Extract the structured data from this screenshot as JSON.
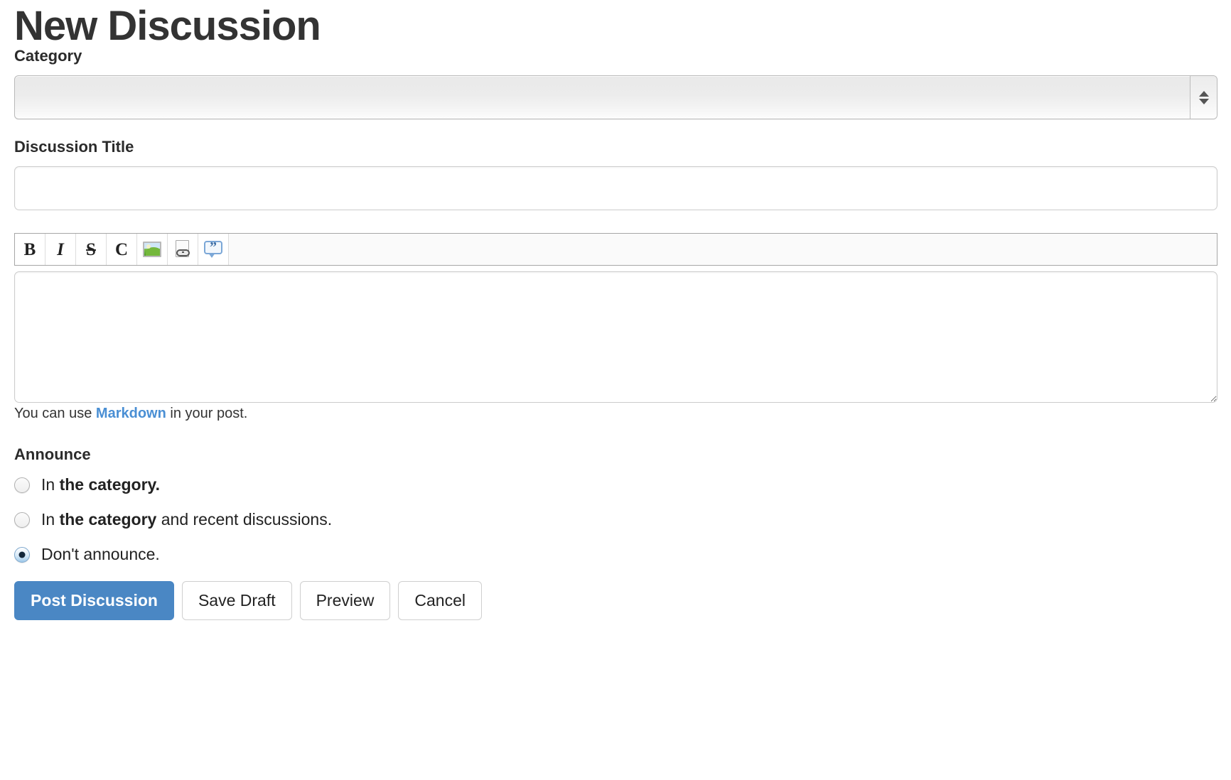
{
  "page": {
    "title": "New Discussion"
  },
  "category": {
    "label": "Category",
    "selected_value": "",
    "stepper_icon": "up-down-arrows-icon"
  },
  "discussion_title": {
    "label": "Discussion Title",
    "value": "",
    "placeholder": ""
  },
  "editor": {
    "toolbar": [
      {
        "name": "bold-button",
        "glyph": "B",
        "style": "bold"
      },
      {
        "name": "italic-button",
        "glyph": "I",
        "style": "italic"
      },
      {
        "name": "strikethrough-button",
        "glyph": "S",
        "style": "strike"
      },
      {
        "name": "code-button",
        "glyph": "C",
        "style": "code"
      },
      {
        "name": "insert-image-button",
        "glyph": "",
        "style": "image-icon"
      },
      {
        "name": "insert-link-button",
        "glyph": "",
        "style": "link-icon"
      },
      {
        "name": "blockquote-button",
        "glyph": "”",
        "style": "quote-icon"
      }
    ],
    "body_value": "",
    "body_placeholder": "",
    "resize_handle_icon": "resize-grip-icon"
  },
  "help": {
    "prefix": "You can use ",
    "link_text": "Markdown",
    "suffix": " in your post."
  },
  "announce": {
    "heading": "Announce",
    "options": [
      {
        "name": "announce-in-category",
        "prefix": "In ",
        "strong": "the category.",
        "suffix": "",
        "checked": false
      },
      {
        "name": "announce-in-category-and-recent",
        "prefix": "In ",
        "strong": "the category",
        "suffix": " and recent discussions.",
        "checked": false
      },
      {
        "name": "announce-none",
        "prefix": "Don't announce.",
        "strong": "",
        "suffix": "",
        "checked": true
      }
    ]
  },
  "buttons": {
    "post": "Post Discussion",
    "save_draft": "Save Draft",
    "preview": "Preview",
    "cancel": "Cancel"
  },
  "colors": {
    "primary": "#4a87c4",
    "link": "#4a8fd4",
    "text": "#333333",
    "border": "#cccccc",
    "toolbar_border": "#a6a6a6"
  }
}
